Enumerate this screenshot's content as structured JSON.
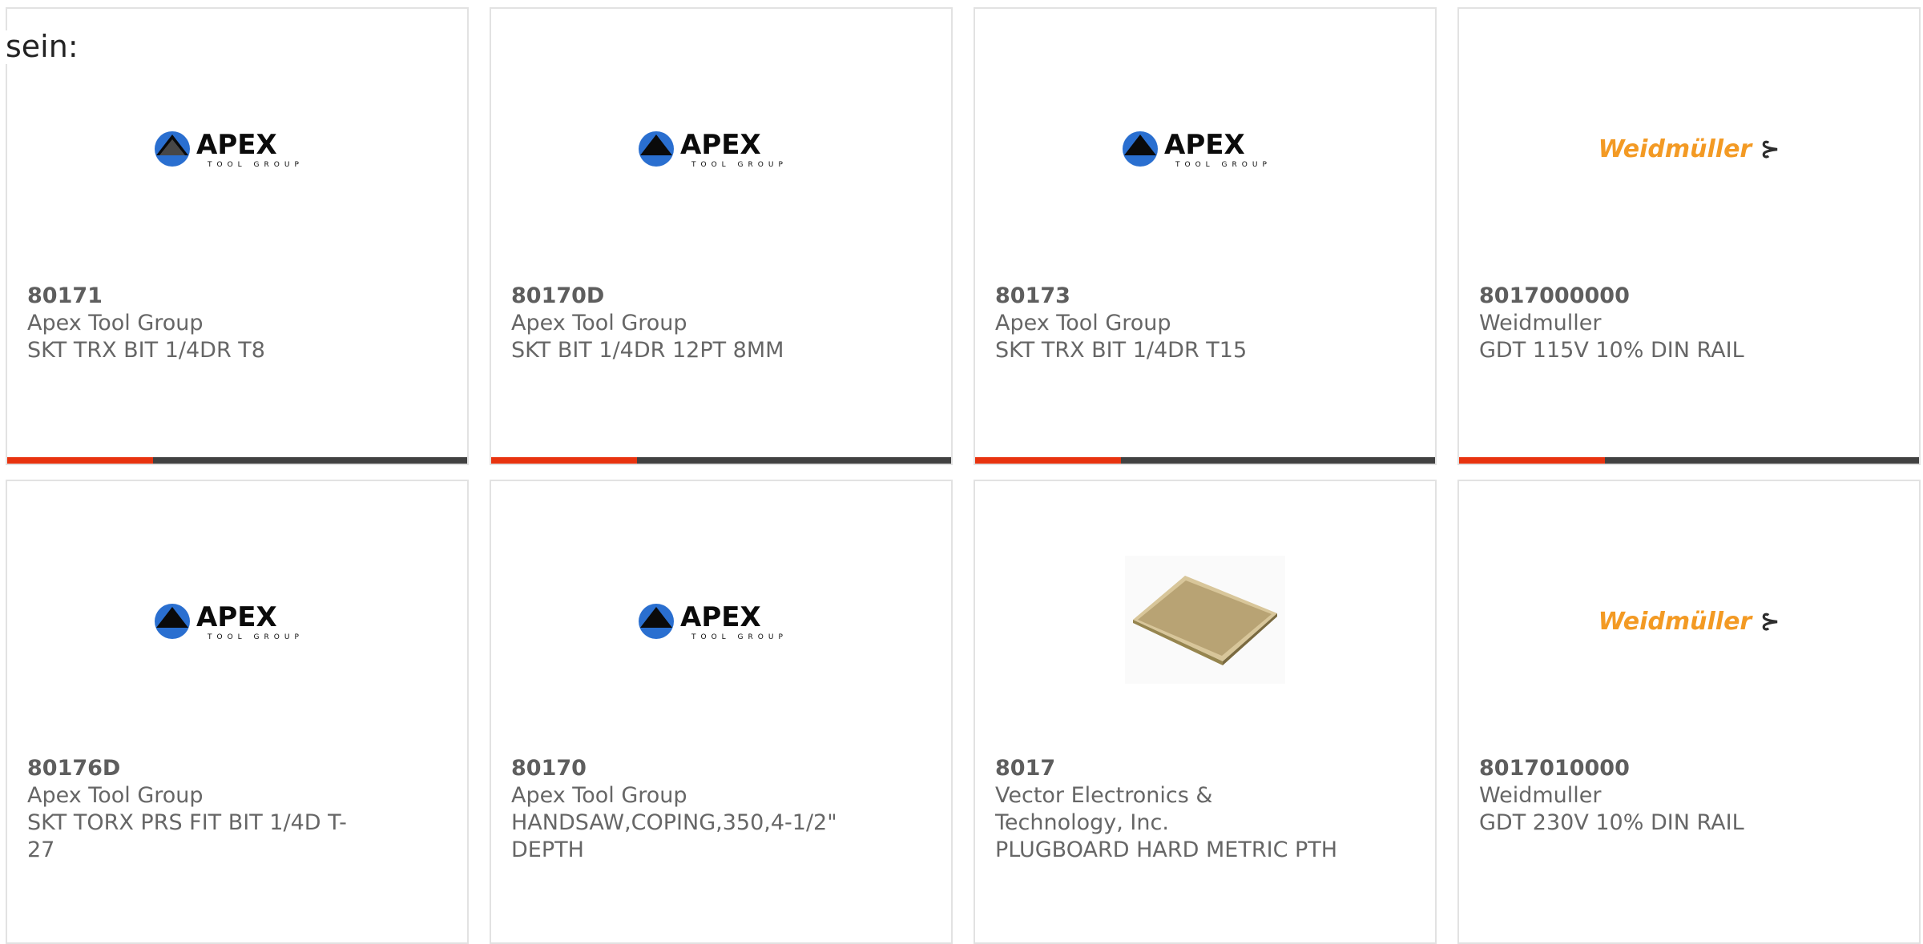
{
  "intro_text": "sein:",
  "cards": [
    {
      "part": "80171",
      "manufacturer": "Apex Tool Group",
      "description": "SKT TRX BIT 1/4DR T8",
      "logo": "APEX",
      "logo_sub": "TOOL GROUP"
    },
    {
      "part": "80170D",
      "manufacturer": "Apex Tool Group",
      "description": "SKT BIT 1/4DR 12PT 8MM",
      "logo": "APEX",
      "logo_sub": "TOOL GROUP"
    },
    {
      "part": "80173",
      "manufacturer": "Apex Tool Group",
      "description": "SKT TRX BIT 1/4DR T15",
      "logo": "APEX",
      "logo_sub": "TOOL GROUP"
    },
    {
      "part": "8017000000",
      "manufacturer": "Weidmuller",
      "description": "GDT 115V 10% DIN RAIL",
      "logo": "Weidmüller"
    },
    {
      "part": "80176D",
      "manufacturer": "Apex Tool Group",
      "description": "SKT TORX PRS FIT BIT 1/4D T-27",
      "logo": "APEX",
      "logo_sub": "TOOL GROUP"
    },
    {
      "part": "80170",
      "manufacturer": "Apex Tool Group",
      "description": "HANDSAW,COPING,350,4-1/2\" DEPTH",
      "logo": "APEX",
      "logo_sub": "TOOL GROUP"
    },
    {
      "part": "8017",
      "manufacturer": "Vector Electronics & Technology, Inc.",
      "description": "PLUGBOARD HARD METRIC PTH"
    },
    {
      "part": "8017010000",
      "manufacturer": "Weidmuller",
      "description": "GDT 230V 10% DIN RAIL",
      "logo": "Weidmüller"
    }
  ],
  "colors": {
    "accent": "#e8330f",
    "bar": "#414141",
    "weidmuller_orange": "#f39a24"
  },
  "icons": {
    "apex": "apex-logo-icon",
    "weidmuller": "weidmuller-logo-icon",
    "board": "plugboard-image"
  }
}
